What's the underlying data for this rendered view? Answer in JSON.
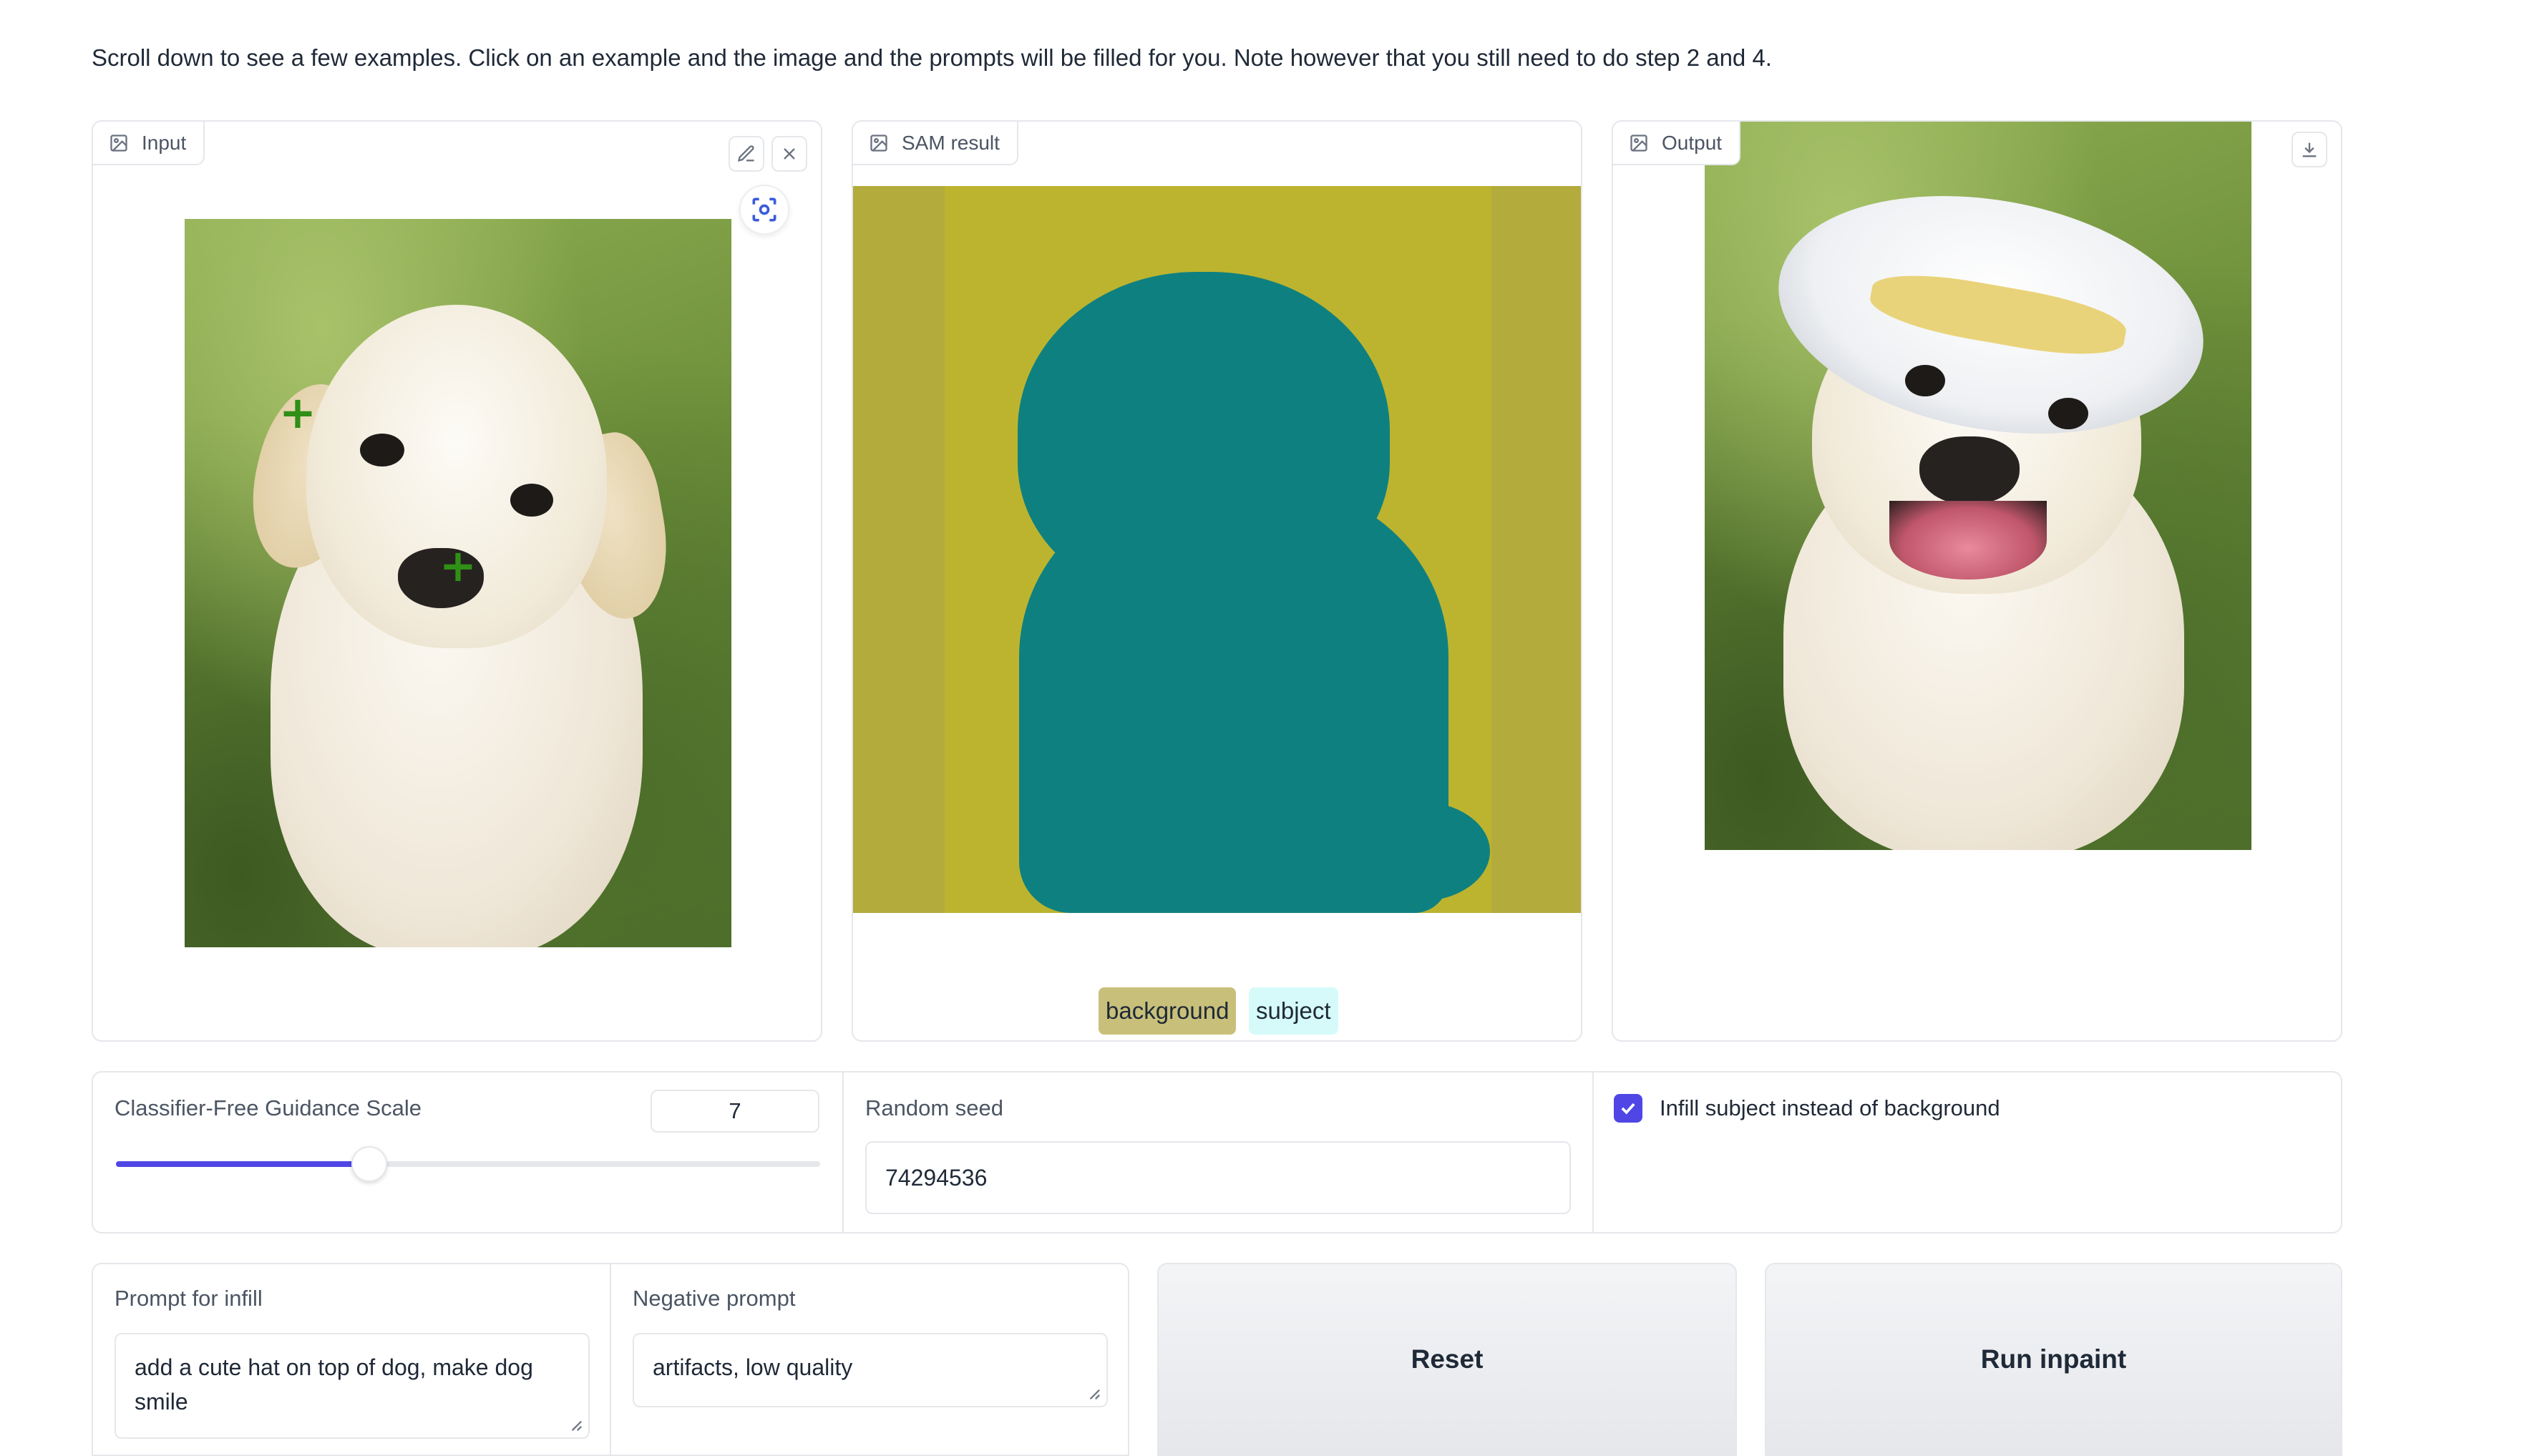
{
  "intro_text": "Scroll down to see a few examples. Click on an example and the image and the prompts will be filled for you. Note however that you still need to do step 2 and 4.",
  "input_panel": {
    "label": "Input",
    "icon": "image-icon",
    "toolbar_icons": [
      "edit-icon",
      "close-icon",
      "focus-icon"
    ],
    "point_markers": [
      "+",
      "+"
    ]
  },
  "sam_panel": {
    "label": "SAM result",
    "icon": "image-icon",
    "legend": [
      {
        "label": "background",
        "color": "#c8c07a"
      },
      {
        "label": "subject",
        "color": "#d6fafa"
      }
    ],
    "mask_colors": {
      "background": "#b3ab3c",
      "subject": "#0f8080"
    }
  },
  "output_panel": {
    "label": "Output",
    "icon": "image-icon",
    "toolbar_icons": [
      "download-icon"
    ]
  },
  "controls": {
    "cfg": {
      "label": "Classifier-Free Guidance Scale",
      "value": "7",
      "fraction": 0.36
    },
    "seed": {
      "label": "Random seed",
      "value": "74294536"
    },
    "infill_subject": {
      "label": "Infill subject instead of background",
      "checked": true
    }
  },
  "prompts": {
    "infill": {
      "label": "Prompt for infill",
      "value": "add a cute hat on top of dog, make dog smile"
    },
    "negative": {
      "label": "Negative prompt",
      "value": "artifacts, low quality"
    }
  },
  "buttons": {
    "reset": "Reset",
    "run": "Run inpaint"
  },
  "colors": {
    "accent": "#4f46e5",
    "border": "#e5e7eb"
  }
}
